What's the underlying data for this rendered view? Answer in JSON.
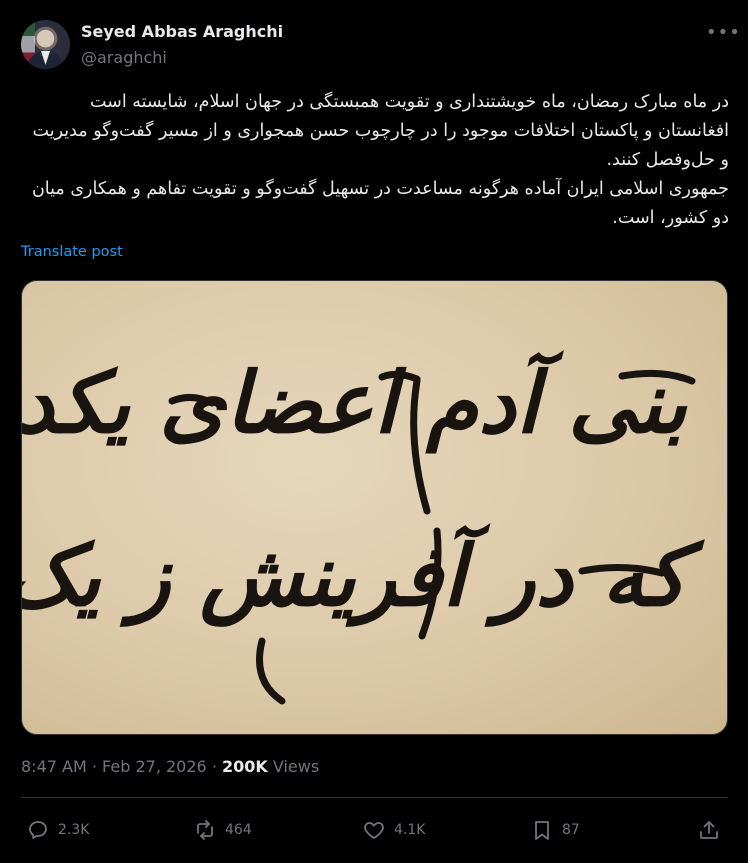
{
  "author": {
    "name": "Seyed Abbas Araghchi",
    "handle": "@araghchi"
  },
  "more_icon": "more-horizontal-icon",
  "post": {
    "paragraph1": "در ماه مبارک رمضان، ماه خویشتنداری و تقویت همبستگی در جهان اسلام، شایسته است افغانستان و پاکستان اختلافات موجود را در چارچوب حسن همجواری و از مسیر گفت‌وگو مدیریت و حل‌وفصل کنند.",
    "paragraph2": "جمهوری اسلامی ایران آماده هرگونه مساعدت در تسهیل گفت‌وگو و تقویت تفاهم و همکاری میان دو کشور، است.",
    "translate_label": "Translate post"
  },
  "media": {
    "line1": "بنی آدم اعضای یکدیگرند",
    "line2": "که در آفرینش ز یک گوهرند",
    "paper_color": "#dcc9a8",
    "ink_color": "#1a1411"
  },
  "meta": {
    "time": "8:47 AM",
    "separator": "·",
    "date": "Feb 27, 2026",
    "views_count": "200K",
    "views_label": "Views"
  },
  "actions": {
    "replies": "2.3K",
    "reposts": "464",
    "likes": "4.1K",
    "bookmarks": "87"
  },
  "colors": {
    "background": "#000000",
    "text": "#e7e9ea",
    "muted": "#71767b",
    "link": "#1d9bf0",
    "border": "#2f3336"
  }
}
